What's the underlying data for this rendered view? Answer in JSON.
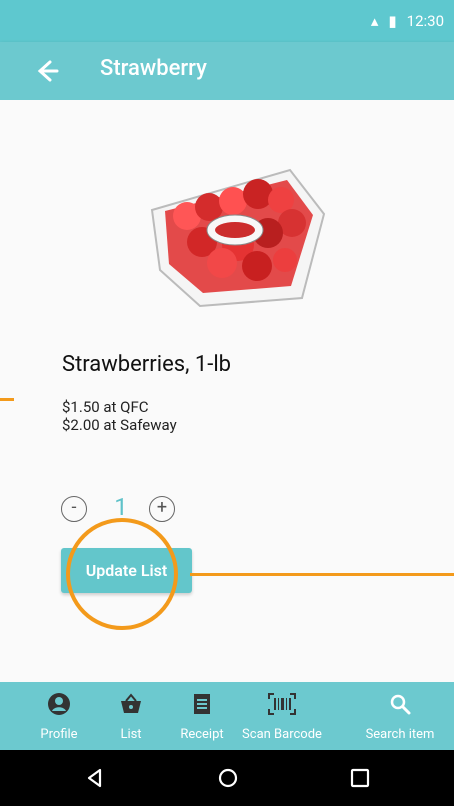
{
  "status": {
    "time": "12:30"
  },
  "appbar": {
    "title": "Strawberry"
  },
  "product": {
    "name": "Strawberries, 1-lb",
    "prices": [
      "$1.50 at QFC",
      "$2.00 at Safeway"
    ],
    "quantity": "1",
    "image_icon": "strawberry-package-image"
  },
  "actions": {
    "update_label": "Update List",
    "minus_label": "-",
    "plus_label": "+"
  },
  "bottom_nav": {
    "items": [
      {
        "label": "Profile",
        "icon": "profile-icon"
      },
      {
        "label": "List",
        "icon": "basket-icon"
      },
      {
        "label": "Receipt",
        "icon": "receipt-icon"
      },
      {
        "label": "Scan Barcode",
        "icon": "barcode-icon"
      },
      {
        "label": "Search item",
        "icon": "search-icon"
      }
    ]
  },
  "colors": {
    "primary": "#6cc9cf",
    "accent": "#f39a1b"
  }
}
